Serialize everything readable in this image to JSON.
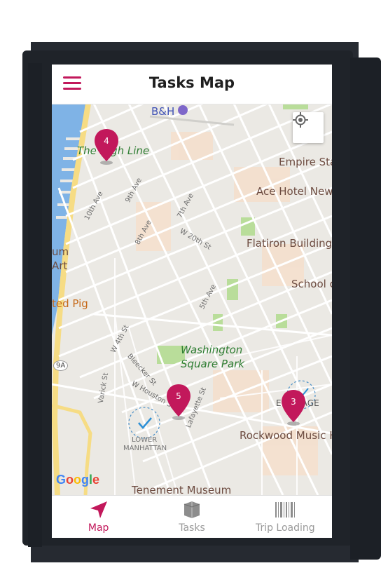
{
  "header": {
    "title": "Tasks Map",
    "menu_icon": "hamburger-icon"
  },
  "map": {
    "labels": {
      "bh": "B&H",
      "high_line": "The High Line",
      "empire": "Empire Sta",
      "ace_hotel": "Ace Hotel New",
      "flatiron": "Flatiron Building",
      "school": "School o",
      "um": "um",
      "art": "Art",
      "pig": "ted Pig",
      "washington1": "Washington",
      "washington2": "Square Park",
      "village": "E VILLAGE",
      "rockwood": "Rockwood Music H",
      "lower": "LOWER",
      "manhattan": "MANHATTAN",
      "tenement": "Tenement Museum",
      "st10": "10th Ave",
      "st9": "9th Ave",
      "st8": "8th Ave",
      "st7": "7th Ave",
      "w20": "W 20th St",
      "ave5": "5th Ave",
      "w4": "W 4th St",
      "bleecker": "Bleecker St",
      "varick": "Varick St",
      "houston": "W Houston St",
      "lafayette": "Lafayette St",
      "route": "9A",
      "google": "Google"
    },
    "pins": [
      {
        "number": "4"
      },
      {
        "number": "5"
      },
      {
        "number": "3"
      }
    ]
  },
  "tabs": [
    {
      "label": "Map",
      "icon": "navigation-arrow-icon",
      "active": true
    },
    {
      "label": "Tasks",
      "icon": "box-icon",
      "active": false
    },
    {
      "label": "Trip Loading",
      "icon": "barcode-icon",
      "active": false
    }
  ],
  "colors": {
    "accent": "#c2185b",
    "pin": "#c2185b"
  }
}
